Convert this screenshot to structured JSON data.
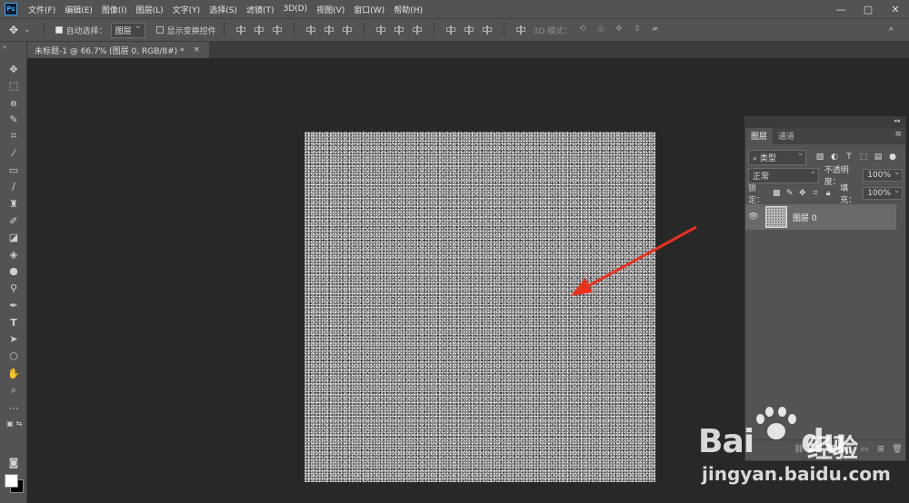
{
  "menubar": {
    "logo": "Ps",
    "items": [
      "文件(F)",
      "编辑(E)",
      "图像(I)",
      "图层(L)",
      "文字(Y)",
      "选择(S)",
      "滤镜(T)",
      "3D(D)",
      "视图(V)",
      "窗口(W)",
      "帮助(H)"
    ],
    "window_controls": [
      "—",
      "▢",
      "✕"
    ]
  },
  "options": {
    "auto_select_label": "自动选择：",
    "auto_select_checked": true,
    "auto_select_target": "图层",
    "show_transform_label": "显示变换控件",
    "mode_3d_label": "3D 模式："
  },
  "document": {
    "tab_title": "未标题-1 @ 66.7% (图层 0, RGB/8#) *",
    "close": "×"
  },
  "colors": {
    "foreground": "#ffffff",
    "background": "#000000",
    "arrow": "#e8321e"
  },
  "layers_panel": {
    "tabs": [
      "图层",
      "通道"
    ],
    "filter_kind": "类型",
    "blend_mode": "正常",
    "opacity_label": "不透明度：",
    "opacity_value": "100%",
    "lock_label": "锁定：",
    "fill_label": "填充：",
    "fill_value": "100%",
    "layers": [
      {
        "name": "图层 0",
        "visible": true
      }
    ]
  },
  "watermark": {
    "brand": "Bai",
    "brand2": "du",
    "cn": "经验",
    "url": "jingyan.baidu.com"
  }
}
